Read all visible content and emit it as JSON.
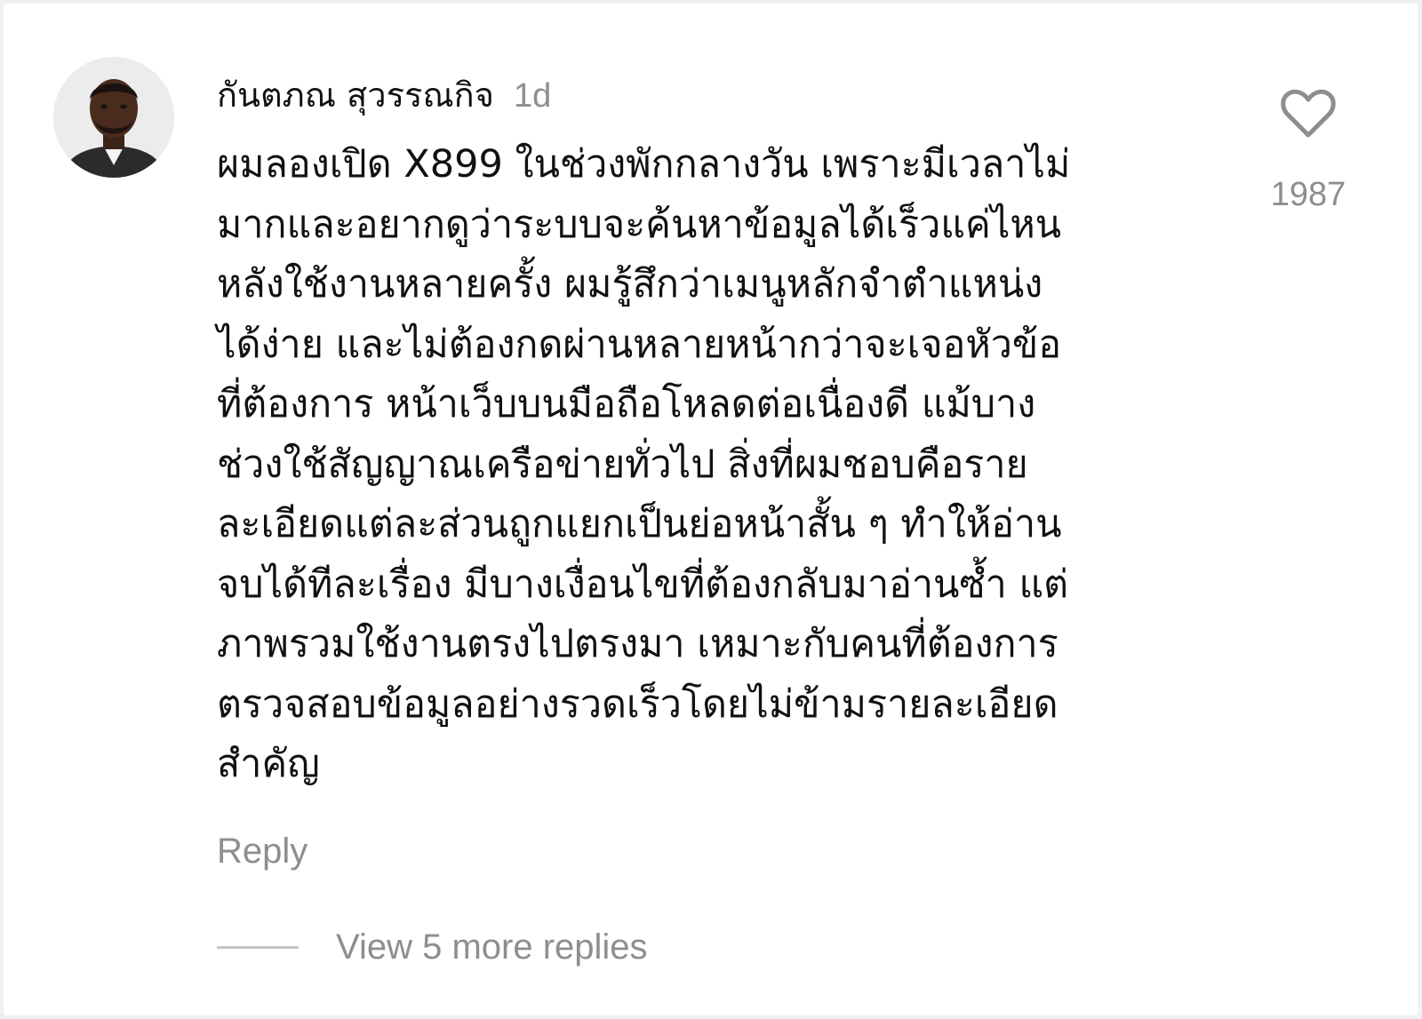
{
  "comment": {
    "author": "กันตภณ สุวรรณกิจ",
    "timestamp": "1d",
    "text": "ผมลองเปิด X899 ในช่วงพักกลางวัน เพราะมีเวลาไม่\nมากและอยากดูว่าระบบจะค้นหาข้อมูลได้เร็วแค่ไหน\nหลังใช้งานหลายครั้ง ผมรู้สึกว่าเมนูหลักจำตำแหน่ง\nได้ง่าย และไม่ต้องกดผ่านหลายหน้ากว่าจะเจอหัวข้อ\nที่ต้องการ หน้าเว็บบนมือถือโหลดต่อเนื่องดี แม้บาง\nช่วงใช้สัญญาณเครือข่ายทั่วไป สิ่งที่ผมชอบคือราย\nละเอียดแต่ละส่วนถูกแยกเป็นย่อหน้าสั้น ๆ ทำให้อ่าน\nจบได้ทีละเรื่อง มีบางเงื่อนไขที่ต้องกลับมาอ่านซ้ำ แต่\nภาพรวมใช้งานตรงไปตรงมา เหมาะกับคนที่ต้องการ\nตรวจสอบข้อมูลอย่างรวดเร็วโดยไม่ข้ามรายละเอียด\nสำคัญ",
    "like_count": "1987",
    "reply_label": "Reply",
    "view_replies_label": "View 5 more replies"
  },
  "icons": {
    "like": "heart-outline-icon"
  },
  "colors": {
    "primary_text": "#111111",
    "secondary_text": "#8e8e8e",
    "divider": "#c7c7c7",
    "background": "#ffffff"
  }
}
